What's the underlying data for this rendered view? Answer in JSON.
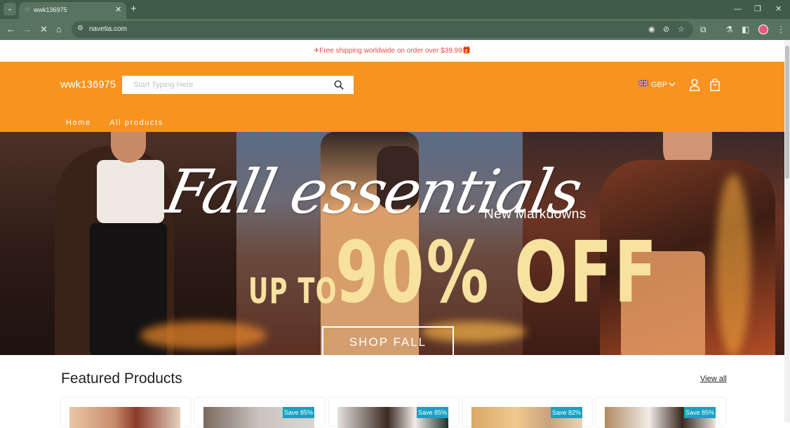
{
  "browser": {
    "tab_title": "wwk136975",
    "url": "navetia.com",
    "new_tab_glyph": "+",
    "close_glyph": "✕"
  },
  "announcement": "✈Free shipping worldwide on order over $39.99🎁",
  "header": {
    "logo": "wwk136975",
    "search_placeholder": "Start Typing Here",
    "currency": "GBP",
    "nav": [
      "Home",
      "All products"
    ]
  },
  "hero": {
    "script": "Fall essentials",
    "markdown": "New Markdowns",
    "upto": "UP TO",
    "discount": "90% OFF",
    "cta": "SHOP FALL"
  },
  "featured": {
    "title": "Featured Products",
    "view_all": "View all",
    "badges": [
      "Save 85%",
      "Save 85%",
      "Save 82%",
      "Save 85%"
    ]
  },
  "colors": {
    "header_orange": "#f7931f",
    "announce_red": "#ec4a4a",
    "badge_teal": "#17a2c2",
    "browser_green": "#577461"
  }
}
